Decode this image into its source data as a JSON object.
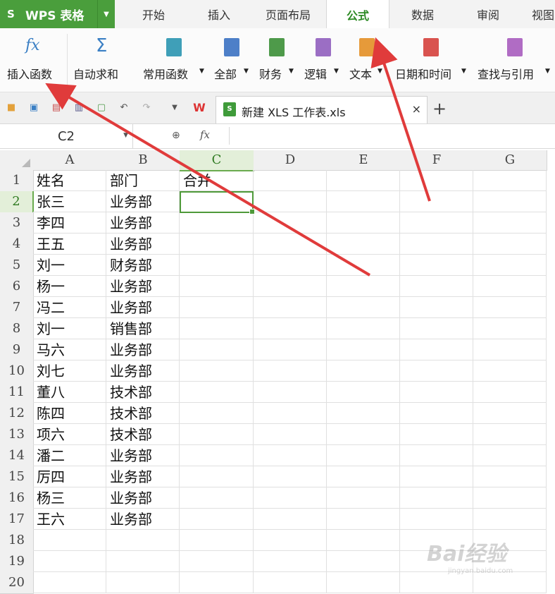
{
  "app": {
    "name": "WPS 表格"
  },
  "menu_tabs": [
    "开始",
    "插入",
    "页面布局",
    "公式",
    "数据",
    "审阅",
    "视图"
  ],
  "active_tab": "公式",
  "ribbon": {
    "insert_function": "插入函数",
    "autosum": "自动求和",
    "common": "常用函数",
    "all": "全部",
    "finance": "财务",
    "logic": "逻辑",
    "text": "文本",
    "datetime": "日期和时间",
    "lookup": "查找与引用",
    "fx_symbol": "fx",
    "sigma_symbol": "Σ"
  },
  "document_tab": {
    "title": "新建 XLS 工作表.xls",
    "close": "×",
    "new": "+"
  },
  "formula_bar": {
    "cell_ref": "C2",
    "fx": "fx",
    "value": ""
  },
  "columns": [
    "A",
    "B",
    "C",
    "D",
    "E",
    "F",
    "G"
  ],
  "rows": [
    {
      "num": "1",
      "a": "姓名",
      "b": "部门",
      "c": "合并"
    },
    {
      "num": "2",
      "a": "张三",
      "b": "业务部",
      "c": ""
    },
    {
      "num": "3",
      "a": "李四",
      "b": "业务部",
      "c": ""
    },
    {
      "num": "4",
      "a": "王五",
      "b": "业务部",
      "c": ""
    },
    {
      "num": "5",
      "a": "刘一",
      "b": "财务部",
      "c": ""
    },
    {
      "num": "6",
      "a": "杨一",
      "b": "业务部",
      "c": ""
    },
    {
      "num": "7",
      "a": "冯二",
      "b": "业务部",
      "c": ""
    },
    {
      "num": "8",
      "a": "刘一",
      "b": "销售部",
      "c": ""
    },
    {
      "num": "9",
      "a": "马六",
      "b": "业务部",
      "c": ""
    },
    {
      "num": "10",
      "a": "刘七",
      "b": "业务部",
      "c": ""
    },
    {
      "num": "11",
      "a": "董八",
      "b": "技术部",
      "c": ""
    },
    {
      "num": "12",
      "a": "陈四",
      "b": "技术部",
      "c": ""
    },
    {
      "num": "13",
      "a": "项六",
      "b": "技术部",
      "c": ""
    },
    {
      "num": "14",
      "a": "潘二",
      "b": "业务部",
      "c": ""
    },
    {
      "num": "15",
      "a": "厉四",
      "b": "业务部",
      "c": ""
    },
    {
      "num": "16",
      "a": "杨三",
      "b": "业务部",
      "c": ""
    },
    {
      "num": "17",
      "a": "王六",
      "b": "业务部",
      "c": ""
    },
    {
      "num": "18",
      "a": "",
      "b": "",
      "c": ""
    },
    {
      "num": "19",
      "a": "",
      "b": "",
      "c": ""
    },
    {
      "num": "20",
      "a": "",
      "b": "",
      "c": ""
    }
  ],
  "watermark": {
    "brand": "Bai经验",
    "url": "jingyan.baidu.com"
  },
  "colors": {
    "accent": "#4a9e3c",
    "arrow": "#e03b3b"
  }
}
